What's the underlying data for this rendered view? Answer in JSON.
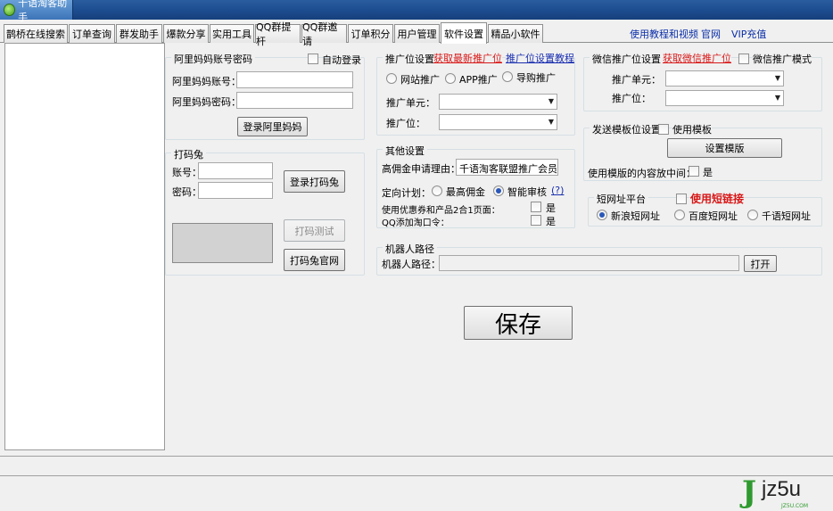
{
  "window": {
    "title": "千语淘客助手"
  },
  "tabs": [
    "鹊桥在线搜索",
    "订单查询",
    "群发助手",
    "爆款分享",
    "实用工具",
    "QQ群提杆",
    "QQ群邀请",
    "订单积分",
    "用户管理",
    "软件设置",
    "精品小软件"
  ],
  "top_links": {
    "tutorial": "使用教程和视频",
    "site": "官网",
    "vip": "VIP充值"
  },
  "alimama": {
    "group_title": "阿里妈妈账号密码",
    "auto_login": "自动登录",
    "account_label": "阿里妈妈账号：",
    "password_label": "阿里妈妈密码：",
    "login_button": "登录阿里妈妈"
  },
  "dama": {
    "group_title": "打码兔",
    "account_label": "账号：",
    "password_label": "密码：",
    "login_button": "登录打码兔",
    "test_button": "打码测试",
    "site_button": "打码兔官网"
  },
  "promo": {
    "group_title": "推广位设置",
    "fetch_link": "获取最新推广位",
    "tutorial_link": "推广位设置教程",
    "radio_site": "网站推广",
    "radio_app": "APP推广",
    "radio_guide": "导购推广",
    "unit_label": "推广单元：",
    "slot_label": "推广位："
  },
  "other": {
    "group_title": "其他设置",
    "reason_label": "高佣金申请理由：",
    "reason_value": "千语淘客联盟推广会员，",
    "plan_label": "定向计划：",
    "plan_max": "最高佣金",
    "plan_smart": "智能审核",
    "plan_help": "(?)",
    "coupon_label": "使用优惠券和产品2合1页面：",
    "coupon_yes": "是",
    "qq_label": "QQ添加淘口令：",
    "qq_yes": "是"
  },
  "robot": {
    "group_title": "机器人路径",
    "path_label": "机器人路径：",
    "open_button": "打开"
  },
  "wechat": {
    "group_title": "微信推广位设置",
    "fetch_link": "获取微信推广位",
    "mode_label": "微信推广模式",
    "unit_label": "推广单元：",
    "slot_label": "推广位："
  },
  "template": {
    "group_title": "发送模板位设置",
    "use_label": "使用模板",
    "set_button": "设置模版",
    "middle_label": "使用模版的内容放中间：",
    "middle_yes": "是"
  },
  "shorturl": {
    "group_title": "短网址平台",
    "use_label": "使用短链接",
    "sina": "新浪短网址",
    "baidu": "百度短网址",
    "qianyu": "千语短网址"
  },
  "save_button": "保存",
  "watermark": {
    "brand": "jz5u",
    "site": "JZ5U.COM"
  },
  "colors": {
    "accent_red": "#d81818",
    "link_blue": "#1a2fb0",
    "title_blue": "#1e4f92"
  }
}
